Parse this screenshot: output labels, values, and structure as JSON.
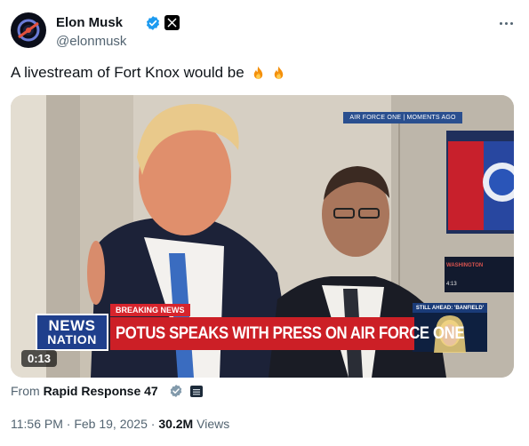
{
  "author": {
    "display_name": "Elon Musk",
    "handle": "@elonmusk",
    "verified_icon": "verified-badge-icon",
    "affiliate_icon": "x-logo-icon"
  },
  "tweet": {
    "text": "A livestream of Fort Knox would be",
    "emoji": [
      "fire-emoji",
      "fire-emoji"
    ]
  },
  "video": {
    "top_tag": "AIR FORCE ONE | MOMENTS AGO",
    "breaking_label": "BREAKING NEWS",
    "headline": "POTUS SPEAKS WITH PRESS ON AIR FORCE ONE",
    "network_line1": "NEWS",
    "network_line2": "NATION",
    "still_ahead": "STILL AHEAD: 'BANFIELD'",
    "monitor_city": "WASHINGTON",
    "monitor_time": "4:13",
    "timecode": "0:13"
  },
  "attribution": {
    "prefix": "From",
    "source": "Rapid Response 47"
  },
  "meta": {
    "time": "11:56 PM",
    "separator": "·",
    "date": "Feb 19, 2025",
    "views_count": "30.2M",
    "views_label": "Views"
  },
  "colors": {
    "verified_blue": "#1d9bf0",
    "breaking_red": "#cc1f26",
    "news_nation_blue": "#1f3f8c",
    "text_primary": "#0f1419",
    "text_secondary": "#536471"
  }
}
